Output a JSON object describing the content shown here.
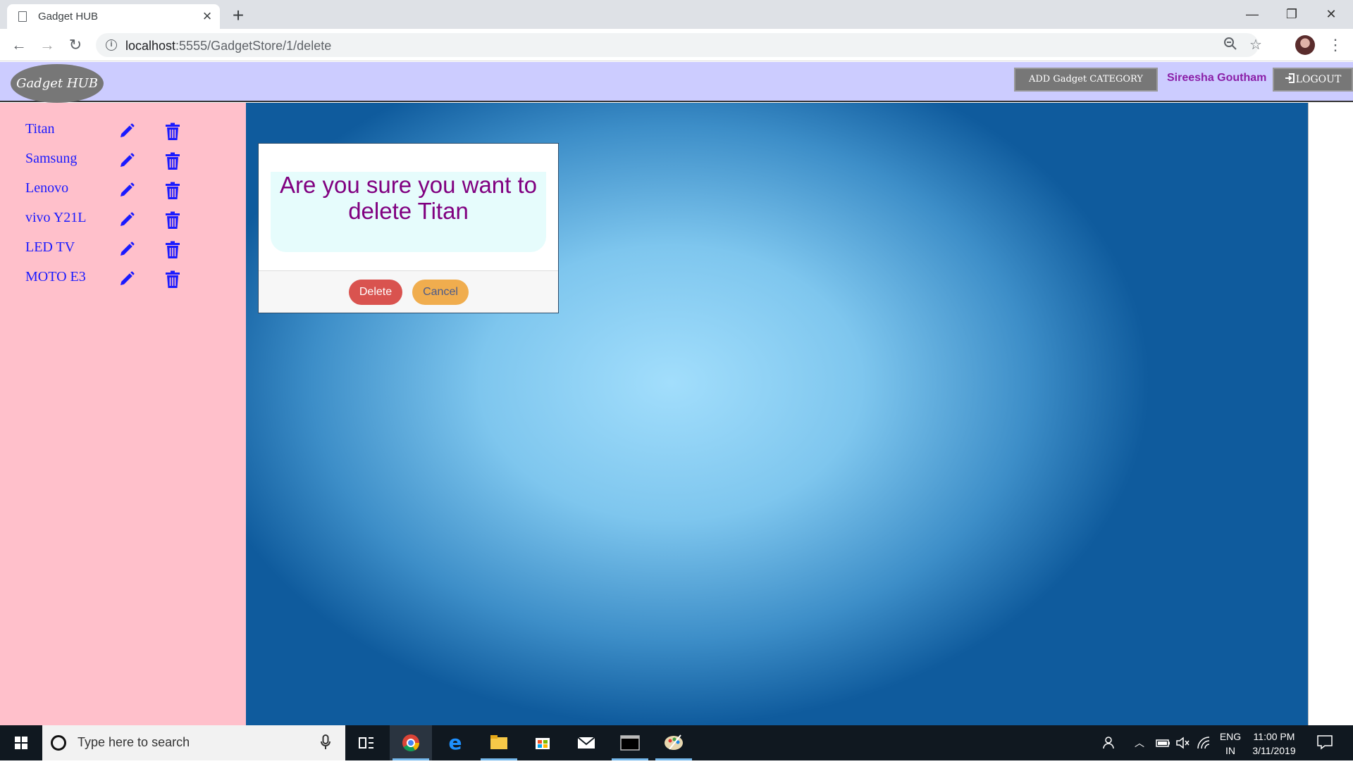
{
  "browser": {
    "tab_title": "Gadget HUB",
    "new_tab": "+",
    "close_tab": "×",
    "url_host": "localhost",
    "url_rest": ":5555/GadgetStore/1/delete",
    "window": {
      "minimize": "—",
      "restore": "❐",
      "close": "✕"
    }
  },
  "header": {
    "logo": "Gadget HUB",
    "add_category": "ADD Gadget CATEGORY",
    "username": "Sireesha Goutham",
    "logout": "LOGOUT"
  },
  "sidebar": {
    "items": [
      {
        "label": "Titan"
      },
      {
        "label": "Samsung"
      },
      {
        "label": "Lenovo"
      },
      {
        "label": "vivo Y21L"
      },
      {
        "label": "LED TV"
      },
      {
        "label": "MOTO E3"
      }
    ]
  },
  "dialog": {
    "message": "Are you sure you want to delete Titan",
    "delete_label": "Delete",
    "cancel_label": "Cancel"
  },
  "taskbar": {
    "search_placeholder": "Type here to search",
    "lang_top": "ENG",
    "lang_bottom": "IN",
    "time": "11:00 PM",
    "date": "3/11/2019"
  },
  "colors": {
    "header_bg": "#ccccff",
    "sidebar_bg": "#ffc0cb",
    "link": "#1a1aff",
    "message": "#800080",
    "delete": "#d9534f",
    "cancel": "#f0ad4e"
  }
}
